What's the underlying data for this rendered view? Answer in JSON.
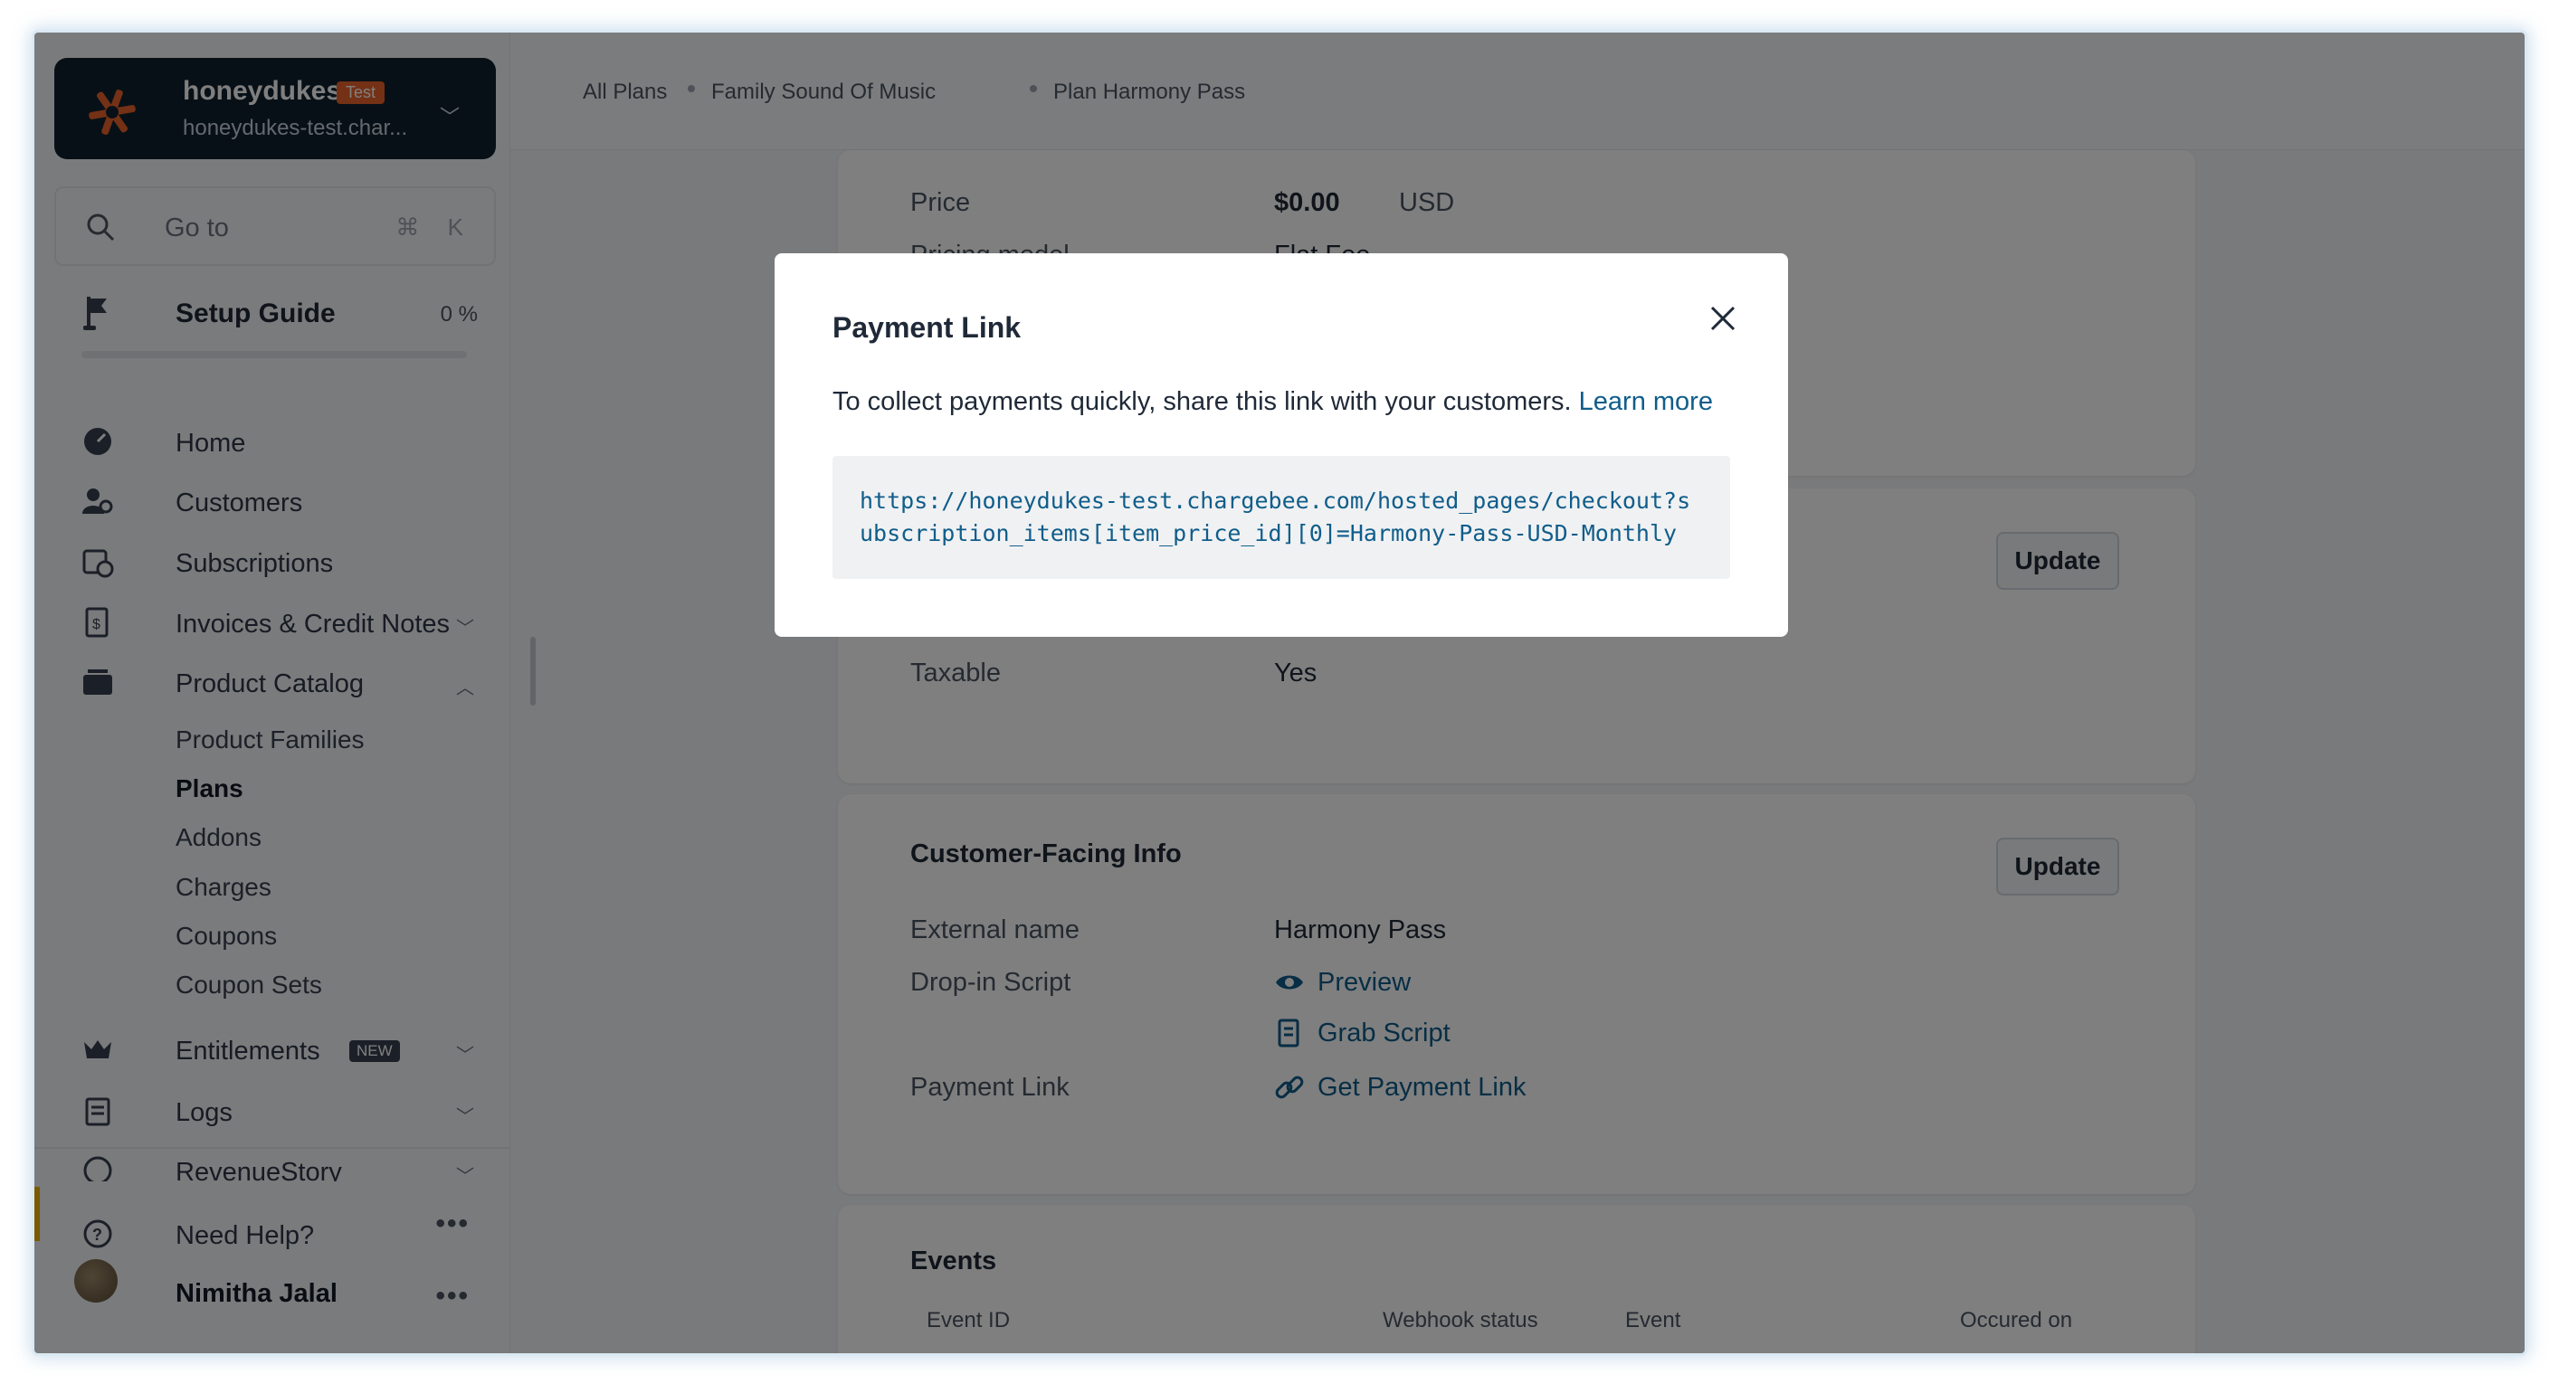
{
  "account": {
    "name": "honeydukes",
    "badge": "Test",
    "domain": "honeydukes-test.char..."
  },
  "search": {
    "placeholder": "Go to",
    "shortcut": "⌘ K"
  },
  "setup_guide": {
    "label": "Setup Guide",
    "progress": "0 %"
  },
  "nav": {
    "home": "Home",
    "customers": "Customers",
    "subscriptions": "Subscriptions",
    "invoices": "Invoices & Credit Notes",
    "product_catalog": "Product Catalog",
    "product_families": "Product Families",
    "plans": "Plans",
    "addons": "Addons",
    "charges": "Charges",
    "coupons": "Coupons",
    "coupon_sets": "Coupon Sets",
    "entitlements": "Entitlements",
    "entitlements_badge": "NEW",
    "logs": "Logs",
    "revenuestory": "RevenueStory",
    "need_help": "Need Help?",
    "user_name": "Nimitha Jalal"
  },
  "breadcrumb": [
    "All Plans",
    "Family Sound Of Music",
    "Plan Harmony Pass"
  ],
  "pricing": {
    "price_label": "Price",
    "price_value": "$0.00",
    "price_currency": "USD",
    "model_label": "Pricing model",
    "model_value": "Flat Fee"
  },
  "tax": {
    "update_label": "Update",
    "taxable_label": "Taxable",
    "taxable_value": "Yes"
  },
  "customer_facing": {
    "title": "Customer-Facing Info",
    "update_label": "Update",
    "external_name_label": "External name",
    "external_name_value": "Harmony Pass",
    "dropin_label": "Drop-in Script",
    "preview_link": "Preview",
    "grab_script_link": "Grab Script",
    "payment_link_label": "Payment Link",
    "get_payment_link": "Get Payment Link"
  },
  "events": {
    "title": "Events",
    "columns": [
      "Event ID",
      "Webhook status",
      "Event",
      "Occured on"
    ]
  },
  "modal": {
    "title": "Payment Link",
    "description": "To collect payments quickly, share this link with your customers.",
    "learn_more": "Learn more",
    "url": "https://honeydukes-test.chargebee.com/hosted_pages/checkout?subscription_items[item_price_id][0]=Harmony-Pass-USD-Monthly"
  },
  "colors": {
    "link": "#0f5d8a",
    "account_bg": "#10212f",
    "badge": "#e8632b"
  }
}
